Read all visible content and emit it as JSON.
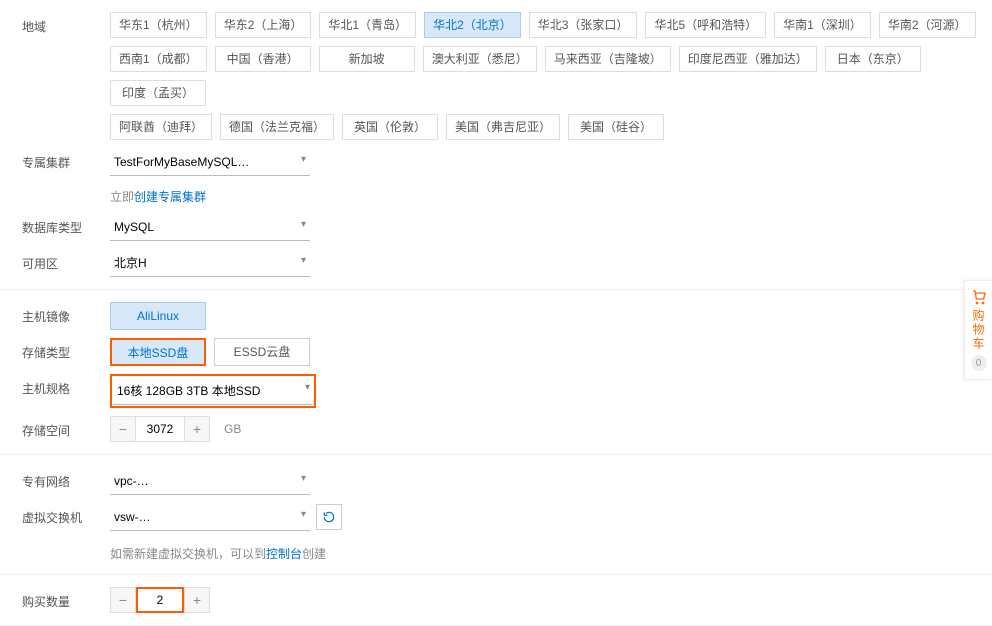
{
  "labels": {
    "region": "地域",
    "cluster": "专属集群",
    "dbType": "数据库类型",
    "zone": "可用区",
    "hostImage": "主机镜像",
    "storageType": "存储类型",
    "hostSpec": "主机规格",
    "storageSpace": "存储空间",
    "vpc": "专有网络",
    "vswitch": "虚拟交换机",
    "quantity": "购买数量"
  },
  "regions": {
    "row1": [
      "华东1（杭州）",
      "华东2（上海）",
      "华北1（青岛）",
      "华北2（北京）",
      "华北3（张家口）",
      "华北5（呼和浩特）",
      "华南1（深圳）",
      "华南2（河源）"
    ],
    "row2": [
      "西南1（成都）",
      "中国（香港）",
      "新加坡",
      "澳大利亚（悉尼）",
      "马来西亚（吉隆坡）",
      "印度尼西亚（雅加达）",
      "日本（东京）",
      "印度（孟买）"
    ],
    "row3": [
      "阿联酋（迪拜）",
      "德国（法兰克福）",
      "英国（伦敦）",
      "美国（弗吉尼亚）",
      "美国（硅谷）"
    ],
    "active": "华北2（北京）"
  },
  "cluster": {
    "value": "TestForMyBaseMySQL…",
    "hintPrefix": "立即",
    "hintLink": "创建专属集群"
  },
  "dbType": {
    "value": "MySQL"
  },
  "zone": {
    "value": "北京H"
  },
  "hostImage": {
    "value": "AliLinux"
  },
  "storageType": {
    "options": [
      "本地SSD盘",
      "ESSD云盘"
    ],
    "active": "本地SSD盘"
  },
  "hostSpec": {
    "value": "16核 128GB 3TB 本地SSD"
  },
  "storageSpace": {
    "value": "3072",
    "unit": "GB"
  },
  "vpc": {
    "value": "vpc-…"
  },
  "vswitch": {
    "value": "vsw-…",
    "hintPrefix": "如需新建虚拟交换机，可以到",
    "hintLink": "控制台",
    "hintSuffix": "创建"
  },
  "quantity": {
    "value": "2"
  },
  "cart": {
    "label": "购物车",
    "count": "0"
  }
}
